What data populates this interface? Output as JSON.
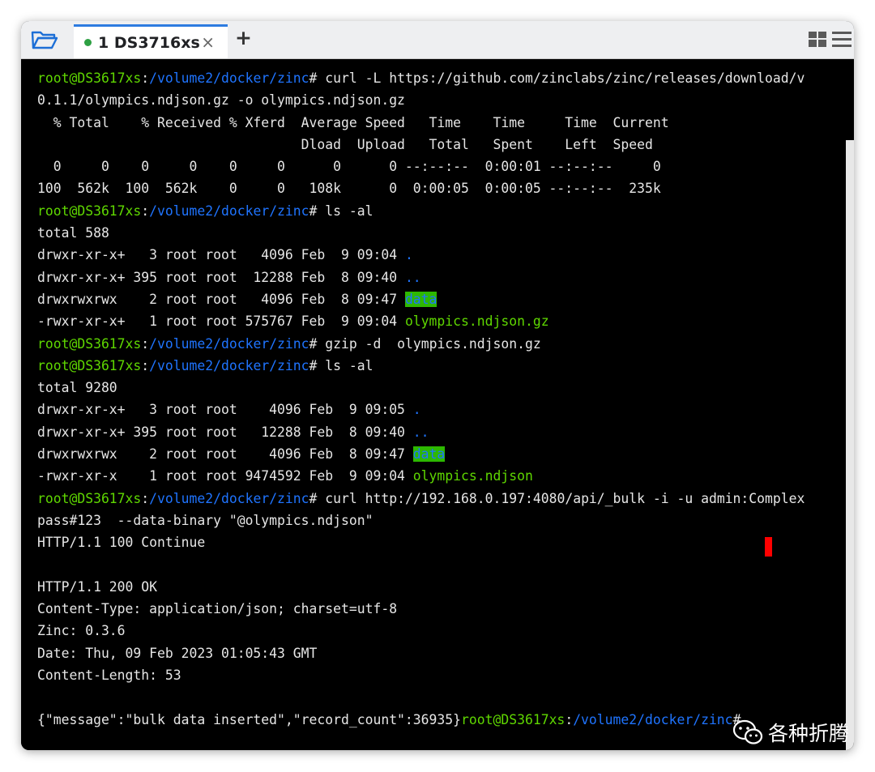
{
  "tab": {
    "number": "1",
    "name": "DS3716xs",
    "close_glyph": "×"
  },
  "toolbar": {
    "new_tab_glyph": "+"
  },
  "prompt": {
    "user": "root@DS3617xs",
    "colon": ":",
    "path": "/volume2/docker/zinc",
    "symbol": "#"
  },
  "terminal": {
    "l1_cmd": " curl -L https://github.com/zinclabs/zinc/releases/download/v",
    "l2": "0.1.1/olympics.ndjson.gz -o olympics.ndjson.gz",
    "l3": "  % Total    % Received % Xferd  Average Speed   Time    Time     Time  Current",
    "l4": "                                 Dload  Upload   Total   Spent    Left  Speed",
    "l5": "  0     0    0     0    0     0      0      0 --:--:--  0:00:01 --:--:--     0",
    "l6": "100  562k  100  562k    0     0   108k      0  0:00:05  0:00:05 --:--:--  235k",
    "l7_cmd": " ls -al",
    "l8": "total 588",
    "l9_pre": "drwxr-xr-x+   3 root root   4096 Feb  9 09:04 ",
    "l9_name": ".",
    "l10_pre": "drwxr-xr-x+ 395 root root  12288 Feb  8 09:40 ",
    "l10_name": "..",
    "l11_pre": "drwxrwxrwx    2 root root   4096 Feb  8 09:47 ",
    "l11_name": "data",
    "l12_pre": "-rwxr-xr-x+   1 root root 575767 Feb  9 09:04 ",
    "l12_name": "olympics.ndjson.gz",
    "l13_cmd": " gzip -d  olympics.ndjson.gz",
    "l14_cmd": " ls -al",
    "l15": "total 9280",
    "l16_pre": "drwxr-xr-x+   3 root root    4096 Feb  9 09:05 ",
    "l16_name": ".",
    "l17_pre": "drwxr-xr-x+ 395 root root   12288 Feb  8 09:40 ",
    "l17_name": "..",
    "l18_pre": "drwxrwxrwx    2 root root    4096 Feb  8 09:47 ",
    "l18_name": "data",
    "l19_pre": "-rwxr-xr-x    1 root root 9474592 Feb  9 09:04 ",
    "l19_name": "olympics.ndjson",
    "l20_cmd": " curl http://192.168.0.197:4080/api/_bulk -i -u admin:Complex",
    "l21": "pass#123  --data-binary \"@olympics.ndjson\"",
    "l22": "HTTP/1.1 100 Continue",
    "l23": "",
    "l24": "HTTP/1.1 200 OK",
    "l25": "Content-Type: application/json; charset=utf-8",
    "l26": "Zinc: 0.3.6",
    "l27": "Date: Thu, 09 Feb 2023 01:05:43 GMT",
    "l28": "Content-Length: 53",
    "l29": "",
    "l30_json": "{\"message\":\"bulk data inserted\",\"record_count\":36935}"
  },
  "watermark": {
    "text": "各种折腾"
  },
  "colors": {
    "user": "#5fd700",
    "path": "#1f74ff",
    "dir_bg": "#2db800",
    "cursor": "#ff0000",
    "tab_accent": "#2d7be0"
  },
  "icons": [
    "folder-open-icon",
    "status-dot-icon",
    "close-icon",
    "plus-icon",
    "layout-grid-icon",
    "hamburger-menu-icon",
    "wechat-icon"
  ]
}
